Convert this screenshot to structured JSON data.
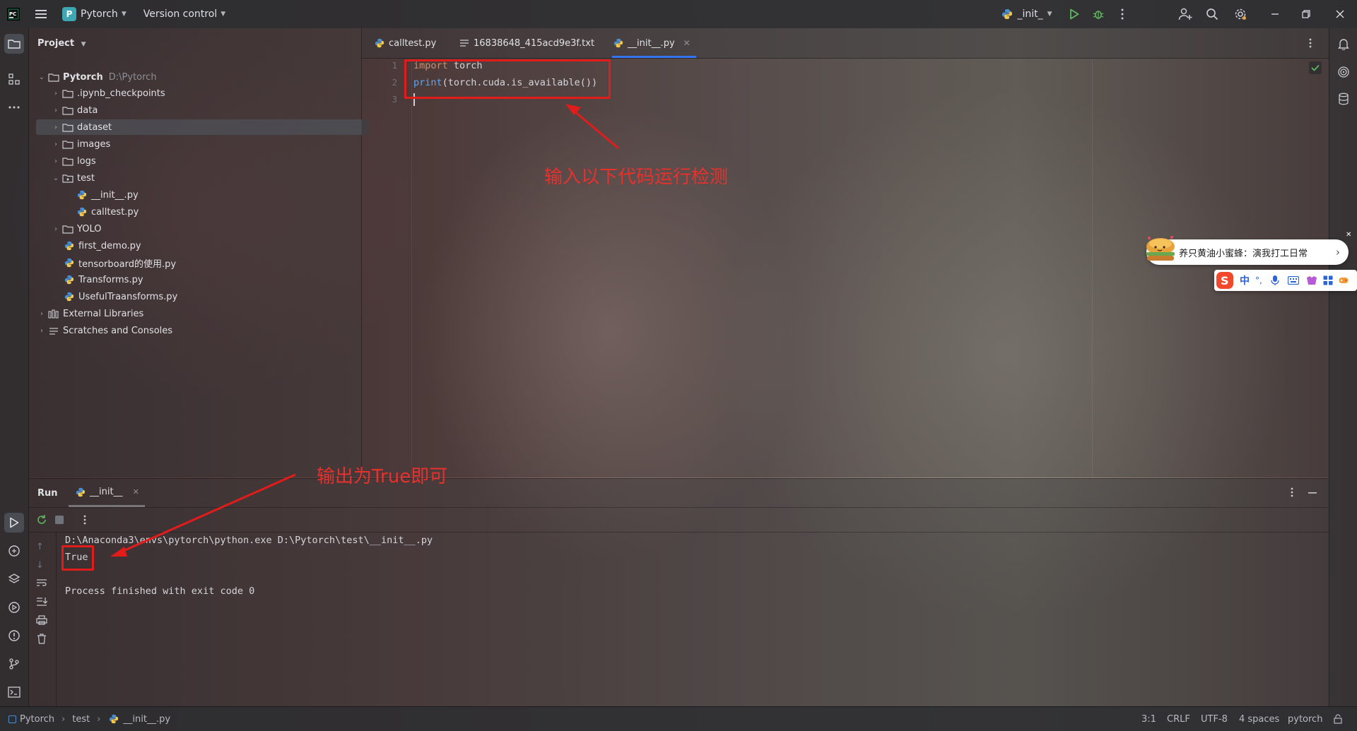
{
  "titlebar": {
    "project_badge": "P",
    "project_name": "Pytorch",
    "version_control": "Version control",
    "run_config": "_init_"
  },
  "project_panel": {
    "header": "Project",
    "root_name": "Pytorch",
    "root_path": "D:\\Pytorch",
    "items": [
      {
        "label": ".ipynb_checkpoints"
      },
      {
        "label": "data"
      },
      {
        "label": "dataset"
      },
      {
        "label": "images"
      },
      {
        "label": "logs"
      },
      {
        "label": "test"
      },
      {
        "label": "__init__.py"
      },
      {
        "label": "calltest.py"
      },
      {
        "label": "YOLO"
      },
      {
        "label": "first_demo.py"
      },
      {
        "label": "tensorboard的使用.py"
      },
      {
        "label": "Transforms.py"
      },
      {
        "label": "UsefulTraansforms.py"
      },
      {
        "label": "External Libraries"
      },
      {
        "label": "Scratches and Consoles"
      }
    ]
  },
  "editor": {
    "tabs": [
      {
        "label": "calltest.py"
      },
      {
        "label": "16838648_415acd9e3f.txt"
      },
      {
        "label": "__init__.py"
      }
    ],
    "line_numbers": [
      "1",
      "2",
      "3"
    ],
    "code": {
      "l1_kw": "import",
      "l1_rest": " torch",
      "l2_fn": "print",
      "l2_rest": "(torch.cuda.is_available())"
    }
  },
  "run": {
    "title": "Run",
    "configuration": "__init__",
    "output": [
      "D:\\Anaconda3\\envs\\pytorch\\python.exe D:\\Pytorch\\test\\__init__.py",
      "True",
      "",
      "Process finished with exit code 0"
    ]
  },
  "statusbar": {
    "breadcrumb": [
      "Pytorch",
      "test",
      "__init__.py"
    ],
    "position": "3:1",
    "line_sep": "CRLF",
    "encoding": "UTF-8",
    "indent": "4 spaces",
    "interpreter": "pytorch"
  },
  "annotations": {
    "code_note": "输入以下代码运行检测",
    "output_note": "输出为True即可"
  },
  "ime": {
    "notice": "养只黄油小蜜蜂：演我打工日常",
    "lang": "中",
    "punct": "°,"
  },
  "colors": {
    "accent": "#3574f0",
    "annotation": "#e21b1b",
    "keyword": "#cf8e6d",
    "function": "#56a8f5",
    "success": "#5fb85f"
  }
}
